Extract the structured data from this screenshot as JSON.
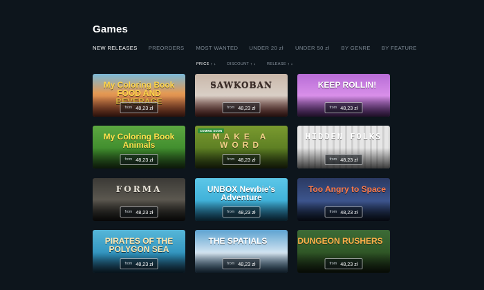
{
  "page": {
    "title": "Games"
  },
  "tabs": [
    {
      "label": "NEW RELEASES",
      "active": true
    },
    {
      "label": "PREORDERS",
      "active": false
    },
    {
      "label": "MOST WANTED",
      "active": false
    },
    {
      "label": "UNDER 20 zł",
      "active": false
    },
    {
      "label": "UNDER 50 zł",
      "active": false
    },
    {
      "label": "BY GENRE",
      "active": false
    },
    {
      "label": "BY FEATURE",
      "active": false
    }
  ],
  "sort": [
    {
      "label": "PRICE",
      "arrows": "↑ ↓",
      "active": true
    },
    {
      "label": "DISCOUNT",
      "arrows": "↑ ↓",
      "active": false
    },
    {
      "label": "RELEASE",
      "arrows": "↑ ↓",
      "active": false
    }
  ],
  "games": [
    {
      "title": "My Coloring Book FOOD AND BEVERAGE",
      "from": "from",
      "price": "48,23 zł"
    },
    {
      "title": "SAWKOBAN",
      "from": "from",
      "price": "48,23 zł"
    },
    {
      "title": "KEEP ROLLIN!",
      "from": "from",
      "price": "48,23 zł"
    },
    {
      "title": "My Coloring Book Animals",
      "from": "from",
      "price": "48,23 zł"
    },
    {
      "title": "MAKE A WORD",
      "badge": "COMING SOON",
      "from": "from",
      "price": "48,23 zł"
    },
    {
      "title": "HIDDEN FOLKS",
      "from": "from",
      "price": "48,23 zł"
    },
    {
      "title": "FORMA",
      "from": "from",
      "price": "48,23 zł"
    },
    {
      "title": "UNBOX Newbie's Adventure",
      "from": "from",
      "price": "48,23 zł"
    },
    {
      "title": "Too Angry to Space",
      "from": "from",
      "price": "48,23 zł"
    },
    {
      "title": "PIRATES OF THE POLYGON SEA",
      "from": "from",
      "price": "48,23 zł"
    },
    {
      "title": "THE SPATIALS",
      "from": "from",
      "price": "48,23 zł"
    },
    {
      "title": "DUNGEON RUSHERS",
      "from": "from",
      "price": "48,23 zł"
    }
  ]
}
